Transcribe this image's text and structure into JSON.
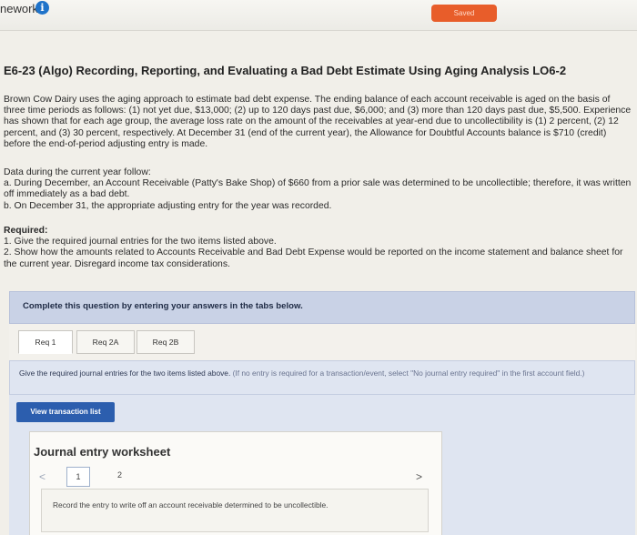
{
  "header": {
    "title": "nework",
    "info_icon": "i",
    "saved_label": "Saved"
  },
  "problem": {
    "title": "E6-23 (Algo) Recording, Reporting, and Evaluating a Bad Debt Estimate Using Aging Analysis LO6-2",
    "intro": "Brown Cow Dairy uses the aging approach to estimate bad debt expense. The ending balance of each account receivable is aged on the basis of three time periods as follows: (1) not yet due, $13,000; (2) up to 120 days past due, $6,000; and (3) more than 120 days past due, $5,500. Experience has shown that for each age group, the average loss rate on the amount of the receivables at year-end due to uncollectibility is (1) 2 percent, (2) 12 percent, and (3) 30 percent, respectively. At December 31 (end of the current year), the Allowance for Doubtful Accounts balance is $710 (credit) before the end-of-period adjusting entry is made.",
    "data_head": "Data during the current year follow:",
    "data_a": "a. During December, an Account Receivable (Patty's Bake Shop) of $660 from a prior sale was determined to be uncollectible; therefore, it was written off immediately as a bad debt.",
    "data_b": "b. On December 31, the appropriate adjusting entry for the year was recorded.",
    "required_head": "Required:",
    "required_1": "1. Give the required journal entries for the two items listed above.",
    "required_2": "2. Show how the amounts related to Accounts Receivable and Bad Debt Expense would be reported on the income statement and balance sheet for the current year. Disregard income tax considerations."
  },
  "panel": {
    "heading": "Complete this question by entering your answers in the tabs below."
  },
  "tabs": [
    "Req 1",
    "Req 2A",
    "Req 2B"
  ],
  "instruction": {
    "main": "Give the required journal entries for the two items listed above.",
    "note": "(If no entry is required for a transaction/event, select \"No journal entry required\" in the first account field.)"
  },
  "worksheet": {
    "view_button": "View transaction list",
    "title": "Journal entry worksheet",
    "prev": "<",
    "page_1": "1",
    "page_2": "2",
    "next": ">",
    "entry_text": "Record the entry to write off an account receivable determined to be uncollectible."
  }
}
